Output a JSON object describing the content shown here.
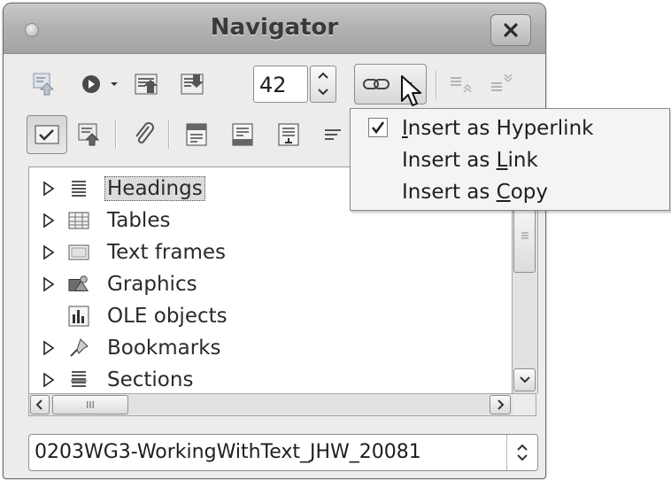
{
  "window": {
    "title": "Navigator"
  },
  "toolbar": {
    "page_number": "42"
  },
  "tree": {
    "items": [
      {
        "label": "Headings",
        "icon": "headings-icon",
        "expandable": true,
        "selected": true
      },
      {
        "label": "Tables",
        "icon": "table-icon",
        "expandable": true
      },
      {
        "label": "Text frames",
        "icon": "text-frame-icon",
        "expandable": true
      },
      {
        "label": "Graphics",
        "icon": "graphics-icon",
        "expandable": true
      },
      {
        "label": "OLE objects",
        "icon": "ole-chart-icon",
        "expandable": false
      },
      {
        "label": "Bookmarks",
        "icon": "pushpin-icon",
        "expandable": true
      },
      {
        "label": "Sections",
        "icon": "sections-icon",
        "expandable": true
      }
    ]
  },
  "scrollbar": {
    "h_thumb_glyph": "III"
  },
  "document_selector": {
    "value": "0203WG3-WorkingWithText_JHW_20081"
  },
  "drag_mode_menu": {
    "items": [
      {
        "label": "Insert as Hyperlink",
        "mnemonic_index": 0,
        "checked": true
      },
      {
        "label": "Insert as Link",
        "mnemonic_index": 10,
        "checked": false
      },
      {
        "label": "Insert as Copy",
        "mnemonic_index": 10,
        "checked": false
      }
    ]
  },
  "colors": {
    "window_bg": "#edeceb",
    "titlebar": "#b3b3b1",
    "selection": "#dcdcdc"
  }
}
